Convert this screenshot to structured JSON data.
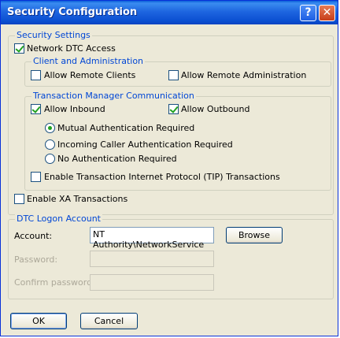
{
  "window": {
    "title": "Security Configuration",
    "help_label": "?",
    "close_label": "✕"
  },
  "security_settings": {
    "legend": "Security Settings",
    "network_dtc_access": {
      "label": "Network DTC Access",
      "checked": true
    },
    "client_admin": {
      "legend": "Client and Administration",
      "allow_remote_clients": {
        "label": "Allow Remote Clients",
        "checked": false
      },
      "allow_remote_admin": {
        "label": "Allow Remote Administration",
        "checked": false
      }
    },
    "tm_comm": {
      "legend": "Transaction Manager Communication",
      "allow_inbound": {
        "label": "Allow Inbound",
        "checked": true
      },
      "allow_outbound": {
        "label": "Allow Outbound",
        "checked": true
      },
      "radio_mutual": {
        "label": "Mutual Authentication Required",
        "checked": true
      },
      "radio_incoming": {
        "label": "Incoming Caller Authentication Required",
        "checked": false
      },
      "radio_none": {
        "label": "No Authentication Required",
        "checked": false
      },
      "enable_tip": {
        "label": "Enable Transaction Internet Protocol (TIP) Transactions",
        "checked": false
      }
    },
    "enable_xa": {
      "label": "Enable XA Transactions",
      "checked": false
    }
  },
  "logon": {
    "legend": "DTC Logon Account",
    "account_label": "Account:",
    "account_value": "NT Authority\\NetworkService",
    "browse_label": "Browse",
    "password_label": "Password:",
    "password_value": "",
    "confirm_label": "Confirm password:",
    "confirm_value": ""
  },
  "buttons": {
    "ok_label": "OK",
    "cancel_label": "Cancel"
  }
}
